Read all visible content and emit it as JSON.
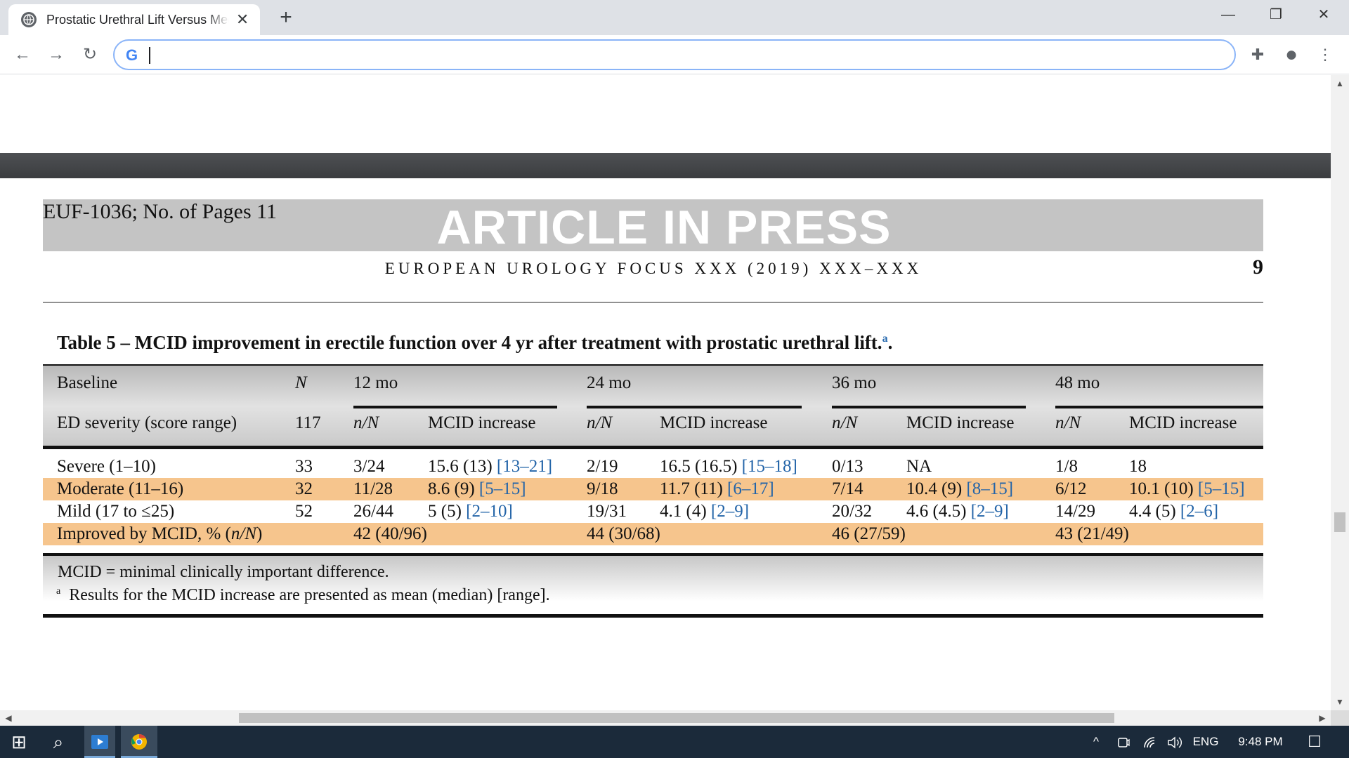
{
  "browser": {
    "tab_title": "Prostatic Urethral Lift Versus Medical Therapy",
    "tab_close": "✕",
    "new_tab": "+",
    "minimize": "—",
    "restore": "❐",
    "close": "✕",
    "back": "←",
    "forward": "→",
    "reload": "↻",
    "omnibox_logo": "G",
    "omnibox_value": "",
    "extensions": "✚",
    "profile": "●",
    "menu": "⋮"
  },
  "scrollbars": {
    "up": "▲",
    "down": "▼",
    "left": "◀",
    "right": "▶"
  },
  "document": {
    "doc_id": "EUF-1036; No. of Pages 11",
    "banner": "ARTICLE IN PRESS",
    "journal": "EUROPEAN UROLOGY FOCUS XXX (2019) XXX–XXX",
    "page_number": "9",
    "caption": "Table 5 – MCID improvement in erectile function over 4 yr after treatment with prostatic urethral lift.",
    "caption_sup": "a",
    "caption_end": "."
  },
  "table": {
    "head1": {
      "baseline": "Baseline",
      "n": "N",
      "g12": "12 mo",
      "g24": "24 mo",
      "g36": "36 mo",
      "g48": "48 mo"
    },
    "head2": {
      "severity": "ED severity (score range)",
      "n_total": "117",
      "nN": "n/N",
      "mcid": "MCID increase"
    },
    "rows": [
      {
        "label": "Severe (1–10)",
        "n": "33",
        "m12": "3/24",
        "v12": "15.6 (13) ",
        "r12": "[13–21]",
        "m24": "2/19",
        "v24": "16.5 (16.5) ",
        "r24": "[15–18]",
        "m36": "0/13",
        "v36": "NA",
        "r36": "",
        "m48": "1/8",
        "v48": "18",
        "r48": ""
      },
      {
        "label": "Moderate (11–16)",
        "n": "32",
        "m12": "11/28",
        "v12": "8.6 (9) ",
        "r12": "[5–15]",
        "m24": "9/18",
        "v24": "11.7 (11) ",
        "r24": "[6–17]",
        "m36": "7/14",
        "v36": "10.4 (9) ",
        "r36": "[8–15]",
        "m48": "6/12",
        "v48": "10.1 (10) ",
        "r48": "[5–15]"
      },
      {
        "label": "Mild (17 to ≤25)",
        "n": "52",
        "m12": "26/44",
        "v12": "5 (5) ",
        "r12": "[2–10]",
        "m24": "19/31",
        "v24": "4.1 (4) ",
        "r24": "[2–9]",
        "m36": "20/32",
        "v36": "4.6 (4.5) ",
        "r36": "[2–9]",
        "m48": "14/29",
        "v48": "4.4 (5) ",
        "r48": "[2–6]"
      }
    ],
    "improved": {
      "label_a": "Improved by MCID, % (",
      "label_it": "n/N",
      "label_b": ")",
      "p12": "42 (40/96)",
      "p24": "44 (30/68)",
      "p36": "46 (27/59)",
      "p48": "43 (21/49)"
    },
    "footnote1": "MCID = minimal clinically important difference.",
    "footnote2_sup": "a",
    "footnote2": "Results for the MCID increase are presented as mean (median) [range]."
  },
  "taskbar": {
    "start": "⊞",
    "search": "⌕",
    "lang": "ENG",
    "time": "9:48 PM",
    "tray_up": "^",
    "notifications": "☐"
  },
  "colors": {
    "highlight_row": "#f6c58d",
    "link": "#2364a8",
    "taskbar": "#1b2a3a"
  }
}
